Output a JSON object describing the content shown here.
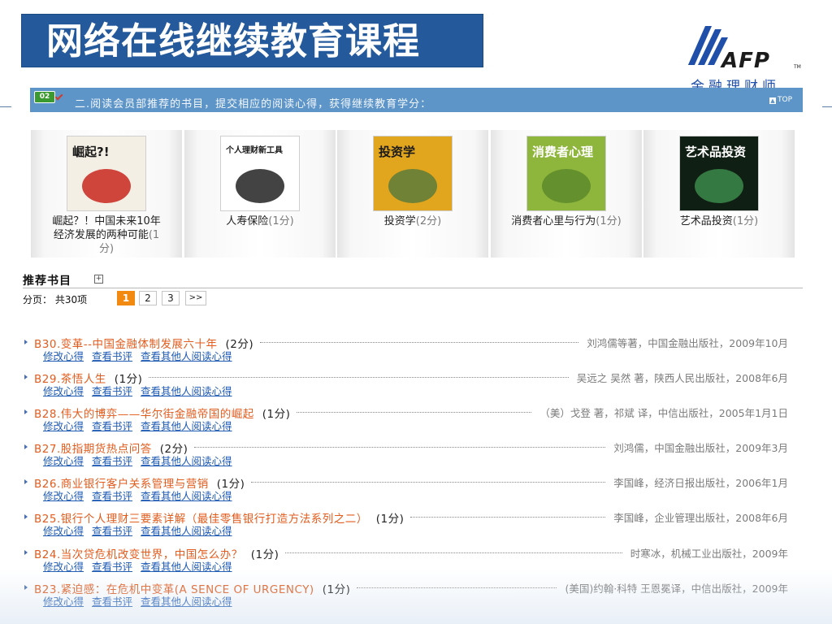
{
  "header": {
    "title": "网络在线继续教育课程",
    "logo_text": "AFP",
    "logo_tm": "TM",
    "logo_cn": "金融理财师"
  },
  "section": {
    "badge": "02",
    "text": "二.阅读会员部推荐的书目，提交相应的阅读心得，获得继续教育学分：",
    "top_link": "TOP"
  },
  "shelf": [
    {
      "caption": "崛起？！中国未来10年经济发展的两种可能",
      "credit": "(1分)",
      "cover_title": "崛起?!",
      "cover_bg": "#f4efe4",
      "cover_fg": "#1a1a1a",
      "cover_accent": "#c8271e"
    },
    {
      "caption": "人寿保险",
      "credit": "(1分)",
      "cover_title": "个人理财新工具",
      "cover_bg": "#ffffff",
      "cover_fg": "#1a1a1a",
      "cover_accent": "#222222"
    },
    {
      "caption": "投资学",
      "credit": "(2分)",
      "cover_title": "投资学",
      "cover_bg": "#e2a51e",
      "cover_fg": "#1a1a1a",
      "cover_accent": "#5a7b3a"
    },
    {
      "caption": "消费者心里与行为",
      "credit": "(1分)",
      "cover_title": "消费者心理",
      "cover_bg": "#8fb63c",
      "cover_fg": "#ffffff",
      "cover_accent": "#5d8a2a"
    },
    {
      "caption": "艺术品投资",
      "credit": "(1分)",
      "cover_title": "艺术品投资",
      "cover_bg": "#101f14",
      "cover_fg": "#ffffff",
      "cover_accent": "#3b8a4a"
    }
  ],
  "recommend": {
    "title": "推荐书目",
    "plus": "+",
    "pager_label": "分页： 共30项",
    "pages": [
      "1",
      "2",
      "3",
      ">>"
    ]
  },
  "books": [
    {
      "title": "B30.变革--中国金融体制发展六十年",
      "credit": "(2分)",
      "publisher": "刘鸿儒等著，中国金融出版社，2009年10月"
    },
    {
      "title": "B29.茶悟人生",
      "credit": "(1分)",
      "publisher": "吴远之 吴然 著，陕西人民出版社，2008年6月"
    },
    {
      "title": "B28.伟大的博弈——华尔街金融帝国的崛起",
      "credit": "(1分)",
      "publisher": "（美）戈登 著，祁斌 译，中信出版社，2005年1月1日"
    },
    {
      "title": "B27.股指期货热点问答",
      "credit": "(2分)",
      "publisher": "刘鸿儒，中国金融出版社，2009年3月"
    },
    {
      "title": "B26.商业银行客户关系管理与营销",
      "credit": "(1分)",
      "publisher": "李国峰，经济日报出版社，2006年1月"
    },
    {
      "title": "B25.银行个人理财三要素详解（最佳零售银行打造方法系列之二）",
      "credit": "(1分)",
      "publisher": "李国峰，企业管理出版社，2008年6月"
    },
    {
      "title": "B24.当次贷危机改变世界，中国怎么办？",
      "credit": "(1分)",
      "publisher": "时寒冰，机械工业出版社，2009年"
    },
    {
      "title": "B23.紧迫感：在危机中变革(A SENCE OF URGENCY)",
      "credit": "(1分)",
      "publisher": "(美国)约翰·科特 王恩冕译，中信出版社，2009年"
    }
  ],
  "link_labels": {
    "edit": "修改心得",
    "review": "查看书评",
    "others": "查看其他人阅读心得"
  }
}
